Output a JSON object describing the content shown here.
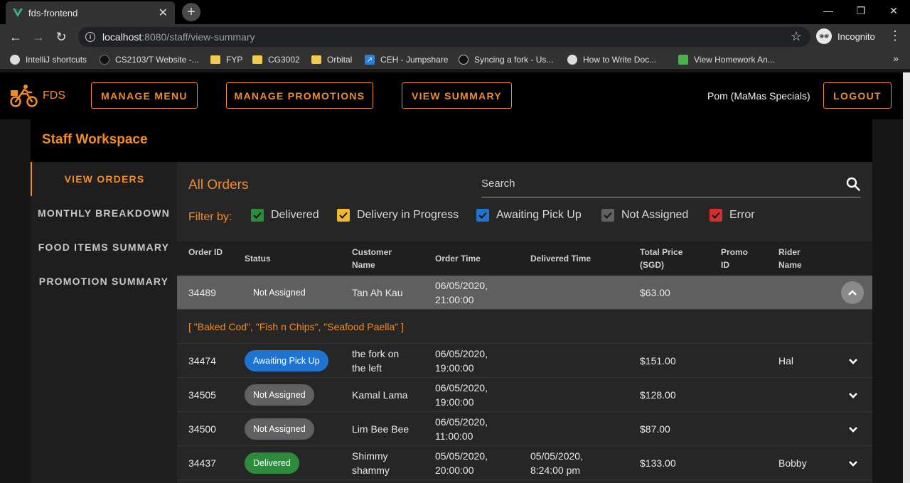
{
  "browser": {
    "tab_title": "fds-frontend",
    "url_host": "localhost",
    "url_path": ":8080/staff/view-summary",
    "incognito_label": "Incognito",
    "bookmarks": [
      {
        "label": "IntelliJ shortcuts",
        "icon": "globe-icon"
      },
      {
        "label": "CS2103/T Website -...",
        "icon": "site-icon"
      },
      {
        "label": "FYP",
        "icon": "folder-icon"
      },
      {
        "label": "CG3002",
        "icon": "folder-icon"
      },
      {
        "label": "Orbital",
        "icon": "folder-icon"
      },
      {
        "label": "CEH - Jumpshare",
        "icon": "jumpshare-icon"
      },
      {
        "label": "Syncing a fork - Us...",
        "icon": "github-icon"
      },
      {
        "label": "How to Write Doc...",
        "icon": "globe-icon"
      },
      {
        "label": "View Homework An...",
        "icon": "doc-icon"
      }
    ]
  },
  "app": {
    "brand": "FDS",
    "nav": [
      "MANAGE MENU",
      "MANAGE PROMOTIONS",
      "VIEW SUMMARY"
    ],
    "user": "Pom (MaMas Specials)",
    "logout": "LOGOUT",
    "workspace_title": "Staff Workspace",
    "accent_color": "#f28c28"
  },
  "sidebar": {
    "items": [
      "VIEW ORDERS",
      "MONTHLY BREAKDOWN",
      "FOOD ITEMS SUMMARY",
      "PROMOTION SUMMARY"
    ],
    "active": "VIEW ORDERS"
  },
  "orders": {
    "title": "All Orders",
    "search_placeholder": "Search",
    "filter_label": "Filter by:",
    "filters": [
      {
        "label": "Delivered",
        "color": "#2e8b3e",
        "checked": true
      },
      {
        "label": "Delivery in Progress",
        "color": "#f2b730",
        "checked": true
      },
      {
        "label": "Awaiting Pick Up",
        "color": "#1e74d0",
        "checked": true
      },
      {
        "label": "Not Assigned",
        "color": "#616161",
        "checked": true
      },
      {
        "label": "Error",
        "color": "#d32f2f",
        "checked": true
      }
    ],
    "columns": {
      "order_id": "Order ID",
      "status": "Status",
      "customer_1": "Customer",
      "customer_2": "Name",
      "order_time": "Order Time",
      "delivered_time": "Delivered Time",
      "total_1": "Total Price",
      "total_2": "(SGD)",
      "promo_1": "Promo",
      "promo_2": "ID",
      "rider_1": "Rider",
      "rider_2": "Name"
    },
    "rows": [
      {
        "id": "34489",
        "status": "Not Assigned",
        "customer_1": "Tan Ah Kau",
        "customer_2": "",
        "order_1": "06/05/2020,",
        "order_2": "21:00:00",
        "deliv_1": "",
        "deliv_2": "",
        "price": "$63.00",
        "rider": "",
        "expanded": true
      },
      {
        "id": "34474",
        "status": "Awaiting Pick Up",
        "customer_1": "the fork on",
        "customer_2": "the left",
        "order_1": "06/05/2020,",
        "order_2": "19:00:00",
        "deliv_1": "",
        "deliv_2": "",
        "price": "$151.00",
        "rider": "Hal"
      },
      {
        "id": "34505",
        "status": "Not Assigned",
        "customer_1": "Kamal Lama",
        "customer_2": "",
        "order_1": "06/05/2020,",
        "order_2": "19:00:00",
        "deliv_1": "",
        "deliv_2": "",
        "price": "$128.00",
        "rider": ""
      },
      {
        "id": "34500",
        "status": "Not Assigned",
        "customer_1": "Lim Bee Bee",
        "customer_2": "",
        "order_1": "06/05/2020,",
        "order_2": "11:00:00",
        "deliv_1": "",
        "deliv_2": "",
        "price": "$87.00",
        "rider": ""
      },
      {
        "id": "34437",
        "status": "Delivered",
        "customer_1": "Shimmy",
        "customer_2": "shammy",
        "order_1": "05/05/2020,",
        "order_2": "20:00:00",
        "deliv_1": "05/05/2020,",
        "deliv_2": "8:24:00 pm",
        "price": "$133.00",
        "rider": "Bobby"
      }
    ],
    "expanded_items": "[ \"Baked Cod\", \"Fish n Chips\", \"Seafood Paella\" ]"
  }
}
